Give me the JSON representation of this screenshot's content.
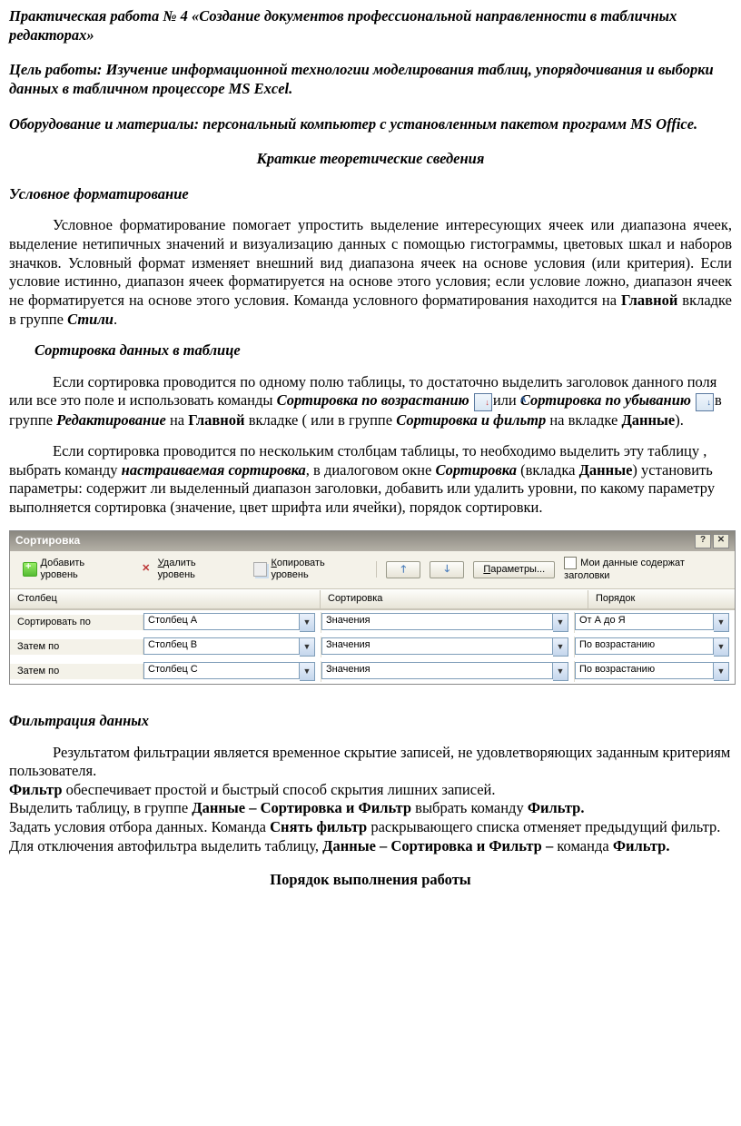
{
  "title": "Практическая работа № 4 «Создание документов профессиональной направленности в табличных редакторах»",
  "goal_label": "Цель работы:",
  "goal_text": " Изучение информационной технологии моделирования таблиц, упорядочивания и выборки данных  в табличном процессоре MS Excel.",
  "equip_label": "Оборудование и материалы:",
  "equip_text": " персональный компьютер с установленным пакетом программ MS Office.",
  "theory_heading": "Краткие теоретические сведения",
  "cond_heading": "Условное форматирование",
  "cond_p1_a": "Условное форматирование помогает упростить  выделение интересующих ячеек или диапазона ячеек, выделение нетипичных значений и визуализацию данных с помощью гистограммы, цветовых шкал и наборов значков. Условный формат изменяет внешний вид диапазона ячеек на основе условия (или критерия). Если условие истинно, диапазон ячеек форматируется на основе этого условия; если условие ложно, диапазон ячеек не форматируется на основе этого условия. Команда условного форматирования находится на ",
  "cond_p1_b": "Главной",
  "cond_p1_c": " вкладке в группе ",
  "cond_p1_d": "Стили",
  "cond_p1_e": ".",
  "sort_heading": "Сортировка данных в таблице",
  "sort_p1_a": "Если сортировка проводится по одному полю таблицы, то достаточно выделить заголовок данного поля  или все это поле и использовать команды ",
  "sort_p1_b": "Сортировка по возрастанию",
  "sort_p1_c": "или ",
  "sort_p1_d": "Сортировка по убыванию",
  "sort_p1_e": "в группе ",
  "sort_p1_f": "Редактирование",
  "sort_p1_g": " на ",
  "sort_p1_h": "Главной",
  "sort_p1_i": " вкладке ( или в группе ",
  "sort_p1_j": "Сортировка и фильтр",
  "sort_p1_k": " на вкладке ",
  "sort_p1_l": "Данные",
  "sort_p1_m": ").",
  "sort_p2_a": "Если сортировка проводится по нескольким столбцам  таблицы, то необходимо выделить эту таблицу , выбрать команду ",
  "sort_p2_b": "настраиваемая сортировка",
  "sort_p2_c": ", в диалоговом окне ",
  "sort_p2_d": "Сортировка",
  "sort_p2_e": " (вкладка ",
  "sort_p2_f": "Данные",
  "sort_p2_g": ") установить параметры:      содержит ли выделенный диапазон заголовки, добавить или удалить уровни, по какому параметру выполняется сортировка (значение, цвет шрифта или ячейки), порядок сортировки.",
  "dialog": {
    "title": "Сортировка",
    "add_u": "Д",
    "add_rest": "обавить уровень",
    "del_u": "У",
    "del_rest": "далить уровень",
    "copy_u": "К",
    "copy_rest": "опировать уровень",
    "params_u": "П",
    "params_rest": "араметры...",
    "mydata": "Мои данные содержат заголовки",
    "col_h1": "Столбец",
    "col_h2": "Сортировка",
    "col_h3": "Порядок",
    "rows": [
      {
        "label": "Сортировать по",
        "c1": "Столбец A",
        "c2": "Значения",
        "c3": "От А до Я"
      },
      {
        "label": "Затем по",
        "c1": "Столбец B",
        "c2": "Значения",
        "c3": "По возрастанию"
      },
      {
        "label": "Затем по",
        "c1": "Столбец C",
        "c2": "Значения",
        "c3": "По возрастанию"
      }
    ]
  },
  "filter_heading": "Фильтрация данных",
  "filter_p1": "Результатом фильтрации является временное скрытие записей, не удовлетворяющих заданным критериям пользователя.",
  "filter_p2_a": "Фильтр",
  "filter_p2_b": " обеспечивает простой и быстрый способ скрытия лишних записей.",
  "filter_p3_a": "Выделить таблицу,  в группе ",
  "filter_p3_b": "Данные – Сортировка и Фильтр",
  "filter_p3_c": " выбрать команду ",
  "filter_p3_d": "Фильтр.",
  "filter_p4_a": "Задать условия отбора данных. Команда ",
  "filter_p4_b": "Снять фильтр",
  "filter_p4_c": " раскрывающего списка отменяет предыдущий фильтр. Для отключения автофильтра  выделить таблицу, ",
  "filter_p4_d": "Данные – Сортировка и Фильтр –",
  "filter_p4_e": " команда ",
  "filter_p4_f": "Фильтр.",
  "order_heading": "Порядок выполнения работы"
}
